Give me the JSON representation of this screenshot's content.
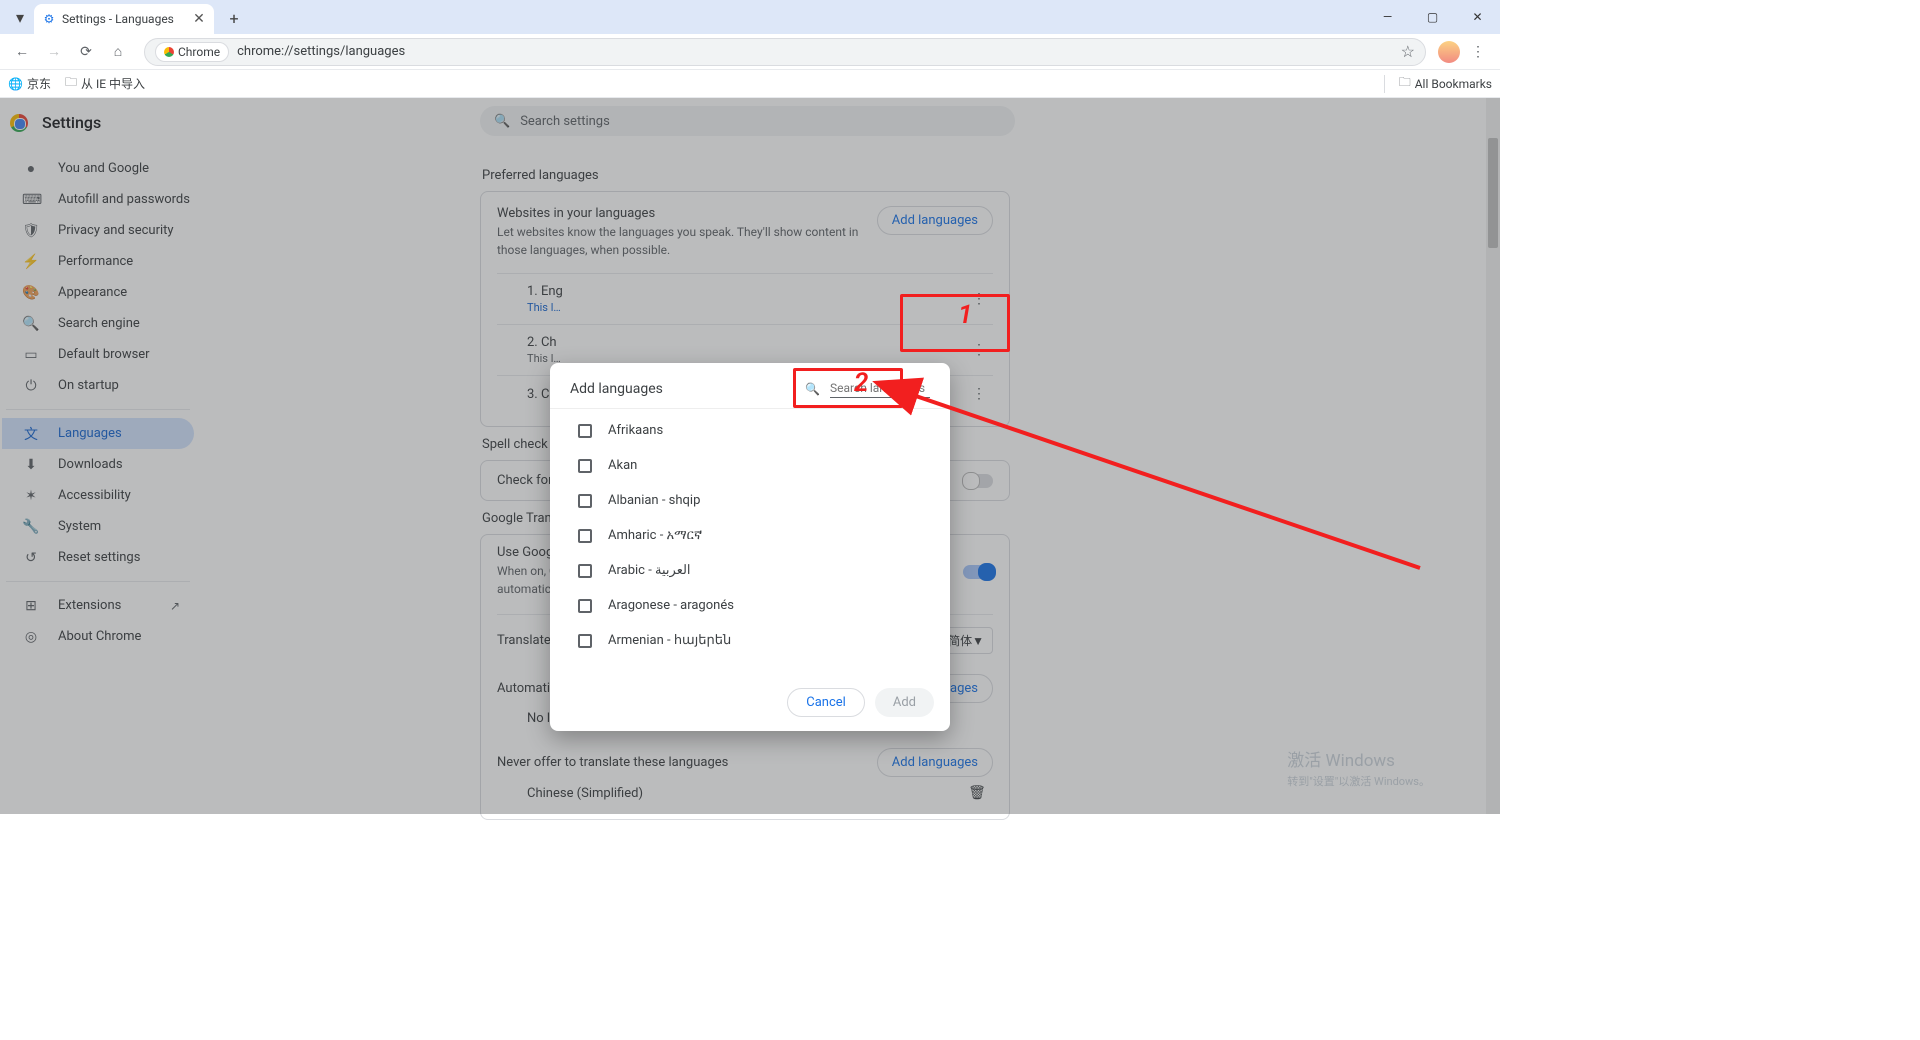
{
  "tab": {
    "title": "Settings - Languages"
  },
  "windowControls": {
    "min": "—",
    "max": "▢",
    "close": "✕"
  },
  "toolbar": {
    "chromePill": "Chrome",
    "url": "chrome://settings/languages"
  },
  "bookmarks": {
    "jd": "京东",
    "ie_import": "从 IE 中导入",
    "all": "All Bookmarks"
  },
  "header": {
    "settings": "Settings",
    "searchPlaceholder": "Search settings"
  },
  "sidebar": {
    "items": [
      {
        "ic": "●",
        "label": "You and Google"
      },
      {
        "ic": "⌨",
        "label": "Autofill and passwords"
      },
      {
        "ic": "🛡",
        "label": "Privacy and security"
      },
      {
        "ic": "⚡",
        "label": "Performance"
      },
      {
        "ic": "🎨",
        "label": "Appearance"
      },
      {
        "ic": "🔍",
        "label": "Search engine"
      },
      {
        "ic": "▭",
        "label": "Default browser"
      },
      {
        "ic": "⏻",
        "label": "On startup"
      }
    ],
    "active": {
      "ic": "文",
      "label": "Languages"
    },
    "items2": [
      {
        "ic": "⬇",
        "label": "Downloads"
      },
      {
        "ic": "✶",
        "label": "Accessibility"
      },
      {
        "ic": "🔧",
        "label": "System"
      },
      {
        "ic": "↺",
        "label": "Reset settings"
      }
    ],
    "extensions": {
      "ic": "⊞",
      "label": "Extensions",
      "ext": "↗"
    },
    "about": {
      "ic": "◎",
      "label": "About Chrome"
    }
  },
  "content": {
    "preferred_label": "Preferred languages",
    "websites": {
      "title": "Websites in your languages",
      "desc": "Let websites know the languages you speak. They'll show content in those languages, when possible.",
      "add": "Add languages",
      "langs": [
        {
          "n": "1. Eng",
          "sub": "This l…"
        },
        {
          "n": "2. Ch",
          "sub": "This l…"
        },
        {
          "n": "3. Chi",
          "sub": ""
        }
      ]
    },
    "spell_label": "Spell check",
    "spell_row": "Check for sp…",
    "translate_label": "Google Transl…",
    "gt_card": {
      "line1": "Use Google T…",
      "line2": "When on, G…",
      "line3": "automatic…"
    },
    "translate_into": "Translate int…",
    "translate_into_value": "…文（简体▼",
    "auto_translate": "Automatically translate these languages",
    "no_lang": "No languages added",
    "never_offer": "Never offer to translate these languages",
    "never_item": "Chinese (Simplified)",
    "add2": "Add languages",
    "add3": "Add languages"
  },
  "dialog": {
    "title": "Add languages",
    "search_placeholder": "Search languages",
    "options": [
      "Afrikaans",
      "Akan",
      "Albanian - shqip",
      "Amharic - አማርኛ",
      "Arabic - العربية",
      "Aragonese - aragonés",
      "Armenian - հայերեն"
    ],
    "cancel": "Cancel",
    "add": "Add"
  },
  "anno": {
    "n1": "1",
    "n2": "2"
  },
  "watermark": {
    "l1": "激活 Windows",
    "l2": "转到\"设置\"以激活 Windows。"
  }
}
